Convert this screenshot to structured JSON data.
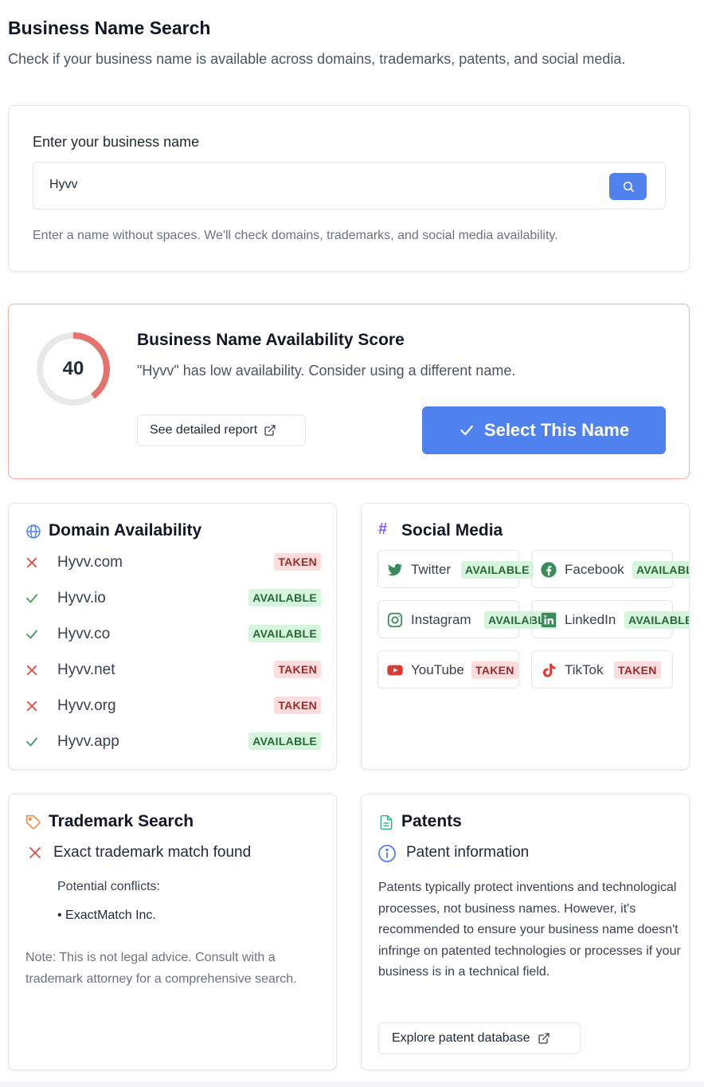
{
  "header": {
    "title": "Business Name Search",
    "subtitle": "Check if your business name is available across domains, trademarks, patents, and social media."
  },
  "search": {
    "label": "Enter your business name",
    "value": "Hyvv",
    "placeholder": "",
    "hint": "Enter a name without spaces. We'll check domains, trademarks, and social media availability."
  },
  "score": {
    "value": "40",
    "percent": 40,
    "title": "Business Name Availability Score",
    "message": "\"Hyvv\" has low availability. Consider using a different name.",
    "report_label": "See detailed report",
    "select_label": "Select This Name",
    "ring_color": "#e5736d"
  },
  "domains": {
    "title": "Domain Availability",
    "items": [
      {
        "name": "Hyvv.com",
        "status": "TAKEN"
      },
      {
        "name": "Hyvv.io",
        "status": "AVAILABLE"
      },
      {
        "name": "Hyvv.co",
        "status": "AVAILABLE"
      },
      {
        "name": "Hyvv.net",
        "status": "TAKEN"
      },
      {
        "name": "Hyvv.org",
        "status": "TAKEN"
      },
      {
        "name": "Hyvv.app",
        "status": "AVAILABLE"
      }
    ]
  },
  "social": {
    "title": "Social Media",
    "items": [
      {
        "name": "Twitter",
        "status": "AVAILABLE",
        "icon": "twitter-icon"
      },
      {
        "name": "Facebook",
        "status": "AVAILABLE",
        "icon": "facebook-icon"
      },
      {
        "name": "Instagram",
        "status": "AVAILABLE",
        "icon": "instagram-icon"
      },
      {
        "name": "LinkedIn",
        "status": "AVAILABLE",
        "icon": "linkedin-icon"
      },
      {
        "name": "YouTube",
        "status": "TAKEN",
        "icon": "youtube-icon"
      },
      {
        "name": "TikTok",
        "status": "TAKEN",
        "icon": "tiktok-icon"
      }
    ]
  },
  "trademark": {
    "title": "Trademark Search",
    "status": "Exact trademark match found",
    "conflicts_label": "Potential conflicts:",
    "conflicts": [
      "• ExactMatch Inc."
    ],
    "note": "Note: This is not legal advice. Consult with a trademark attorney for a comprehensive search."
  },
  "patents": {
    "title": "Patents",
    "subtitle": "Patent information",
    "text": "Patents typically protect inventions and technological processes, not business names. However, it's recommended to ensure your business name doesn't infringe on patented technologies or processes if your business is in a technical field.",
    "button_label": "Explore patent database"
  },
  "colors": {
    "accent": "#4f82ef",
    "taken_bg": "#fcdcdc",
    "taken_fg": "#9b2c2c",
    "available_bg": "#d6f5dd",
    "available_fg": "#276738"
  }
}
